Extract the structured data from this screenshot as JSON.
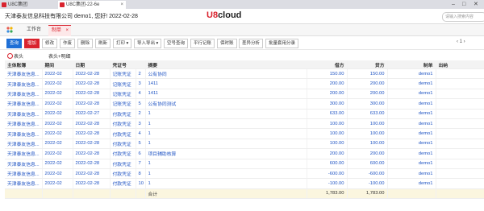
{
  "browser": {
    "tabs": [
      {
        "label": "U8C集团",
        "active": false
      },
      {
        "label": "U8C集团-22-6e",
        "active": true
      }
    ],
    "minimize": "–",
    "restore": "□",
    "close": "✕"
  },
  "header": {
    "company_user": "天津泰友信息科技有限公司 demo1, 您好! 2022-02-28",
    "logo_prefix": "U8",
    "logo_suffix": "cloud",
    "search_placeholder": "请输入搜索内容"
  },
  "workbench": {
    "home_label": "工作台",
    "active_tab": "制单",
    "close_glyph": "×"
  },
  "toolbar": {
    "buttons": [
      "查询",
      "增加",
      "修改",
      "作废",
      "删除",
      "刷新",
      "打印",
      "导入导出",
      "空号查询",
      "平行记账",
      "保时账",
      "差异分析",
      "批量套用分录"
    ],
    "pager": "‹ 1 ›"
  },
  "filter": {
    "radio_label": "表头",
    "subtitle": "表头+明细"
  },
  "table": {
    "headers": [
      "主体账簿",
      "期间",
      "日期",
      "凭证号",
      "",
      "摘要",
      "借方",
      "贷方",
      "制单",
      "出纳"
    ],
    "rows": [
      [
        "天津泰友信息...",
        "2022-02",
        "2022-02-28",
        "记账凭证",
        "2",
        "公有协同",
        "150.00",
        "150.00",
        "demo1",
        ""
      ],
      [
        "天津泰友信息...",
        "2022-02",
        "2022-02-28",
        "记账凭证",
        "3",
        "1411",
        "200.00",
        "200.00",
        "demo1",
        ""
      ],
      [
        "天津泰友信息...",
        "2022-02",
        "2022-02-28",
        "记账凭证",
        "4",
        "1411",
        "200.00",
        "200.00",
        "demo1",
        ""
      ],
      [
        "天津泰友信息...",
        "2022-02",
        "2022-02-28",
        "记账凭证",
        "5",
        "公有协同测试",
        "300.00",
        "300.00",
        "demo1",
        ""
      ],
      [
        "天津泰友信息...",
        "2022-02",
        "2022-02-27",
        "付款凭证",
        "2",
        "1",
        "633.00",
        "633.00",
        "demo1",
        ""
      ],
      [
        "天津泰友信息...",
        "2022-02",
        "2022-02-28",
        "付款凭证",
        "3",
        "1",
        "100.00",
        "100.00",
        "demo1",
        ""
      ],
      [
        "天津泰友信息...",
        "2022-02",
        "2022-02-28",
        "付款凭证",
        "4",
        "1",
        "100.00",
        "100.00",
        "demo1",
        ""
      ],
      [
        "天津泰友信息...",
        "2022-02",
        "2022-02-28",
        "付款凭证",
        "5",
        "1",
        "100.00",
        "100.00",
        "demo1",
        ""
      ],
      [
        "天津泰友信息...",
        "2022-02",
        "2022-02-28",
        "付款凭证",
        "6",
        "项目辅助核算",
        "200.00",
        "200.00",
        "demo1",
        ""
      ],
      [
        "天津泰友信息...",
        "2022-02",
        "2022-02-28",
        "付款凭证",
        "7",
        "1",
        "600.00",
        "600.00",
        "demo1",
        ""
      ],
      [
        "天津泰友信息...",
        "2022-02",
        "2022-02-28",
        "付款凭证",
        "8",
        "1",
        "-600.00",
        "-600.00",
        "demo1",
        ""
      ],
      [
        "天津泰友信息...",
        "2022-02",
        "2022-02-28",
        "付款凭证",
        "10",
        "1",
        "-100.00",
        "-100.00",
        "demo1",
        ""
      ]
    ],
    "total": {
      "label": "合计",
      "debit": "1,783.00",
      "credit": "1,783.00"
    }
  }
}
